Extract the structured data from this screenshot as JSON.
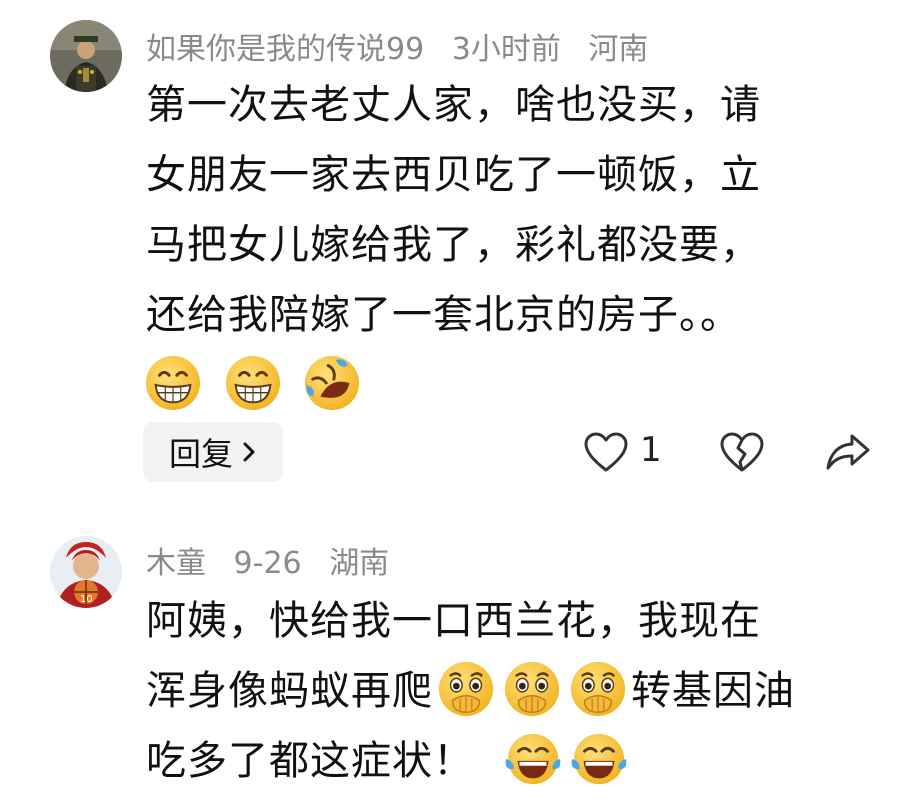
{
  "comments": [
    {
      "username": "如果你是我的传说99",
      "time": "3小时前",
      "location": "河南",
      "lines": [
        "第一次去老丈人家，啥也没买，请",
        "女朋友一家去西贝吃了一顿饭，立",
        "马把女儿嫁给我了，彩礼都没要，",
        "还给我陪嫁了一套北京的房子。。"
      ],
      "emojis": [
        "grin-emoji",
        "grin-emoji",
        "rolling-laugh-emoji"
      ],
      "reply_label": "回复",
      "like_count": "1",
      "icons": [
        "heart-icon",
        "broken-heart-icon",
        "share-icon",
        "chevron-right-icon"
      ]
    },
    {
      "username": "木童",
      "time": "9-26",
      "location": "湖南",
      "line1": "阿姨，快给我一口西兰花，我现在",
      "line2a": "浑身像蚂蚁再爬",
      "line2b": "转基因油",
      "line3": "吃多了都这症状！",
      "emojis_mid": [
        "hand-over-mouth-emoji",
        "hand-over-mouth-emoji",
        "hand-over-mouth-emoji"
      ],
      "emojis_end": [
        "tears-of-joy-emoji",
        "tears-of-joy-emoji"
      ]
    }
  ],
  "colors": {
    "meta_gray": "#8a8a8a",
    "reply_bg": "#f3f3f3",
    "emoji_yellow": "#f7c531"
  }
}
